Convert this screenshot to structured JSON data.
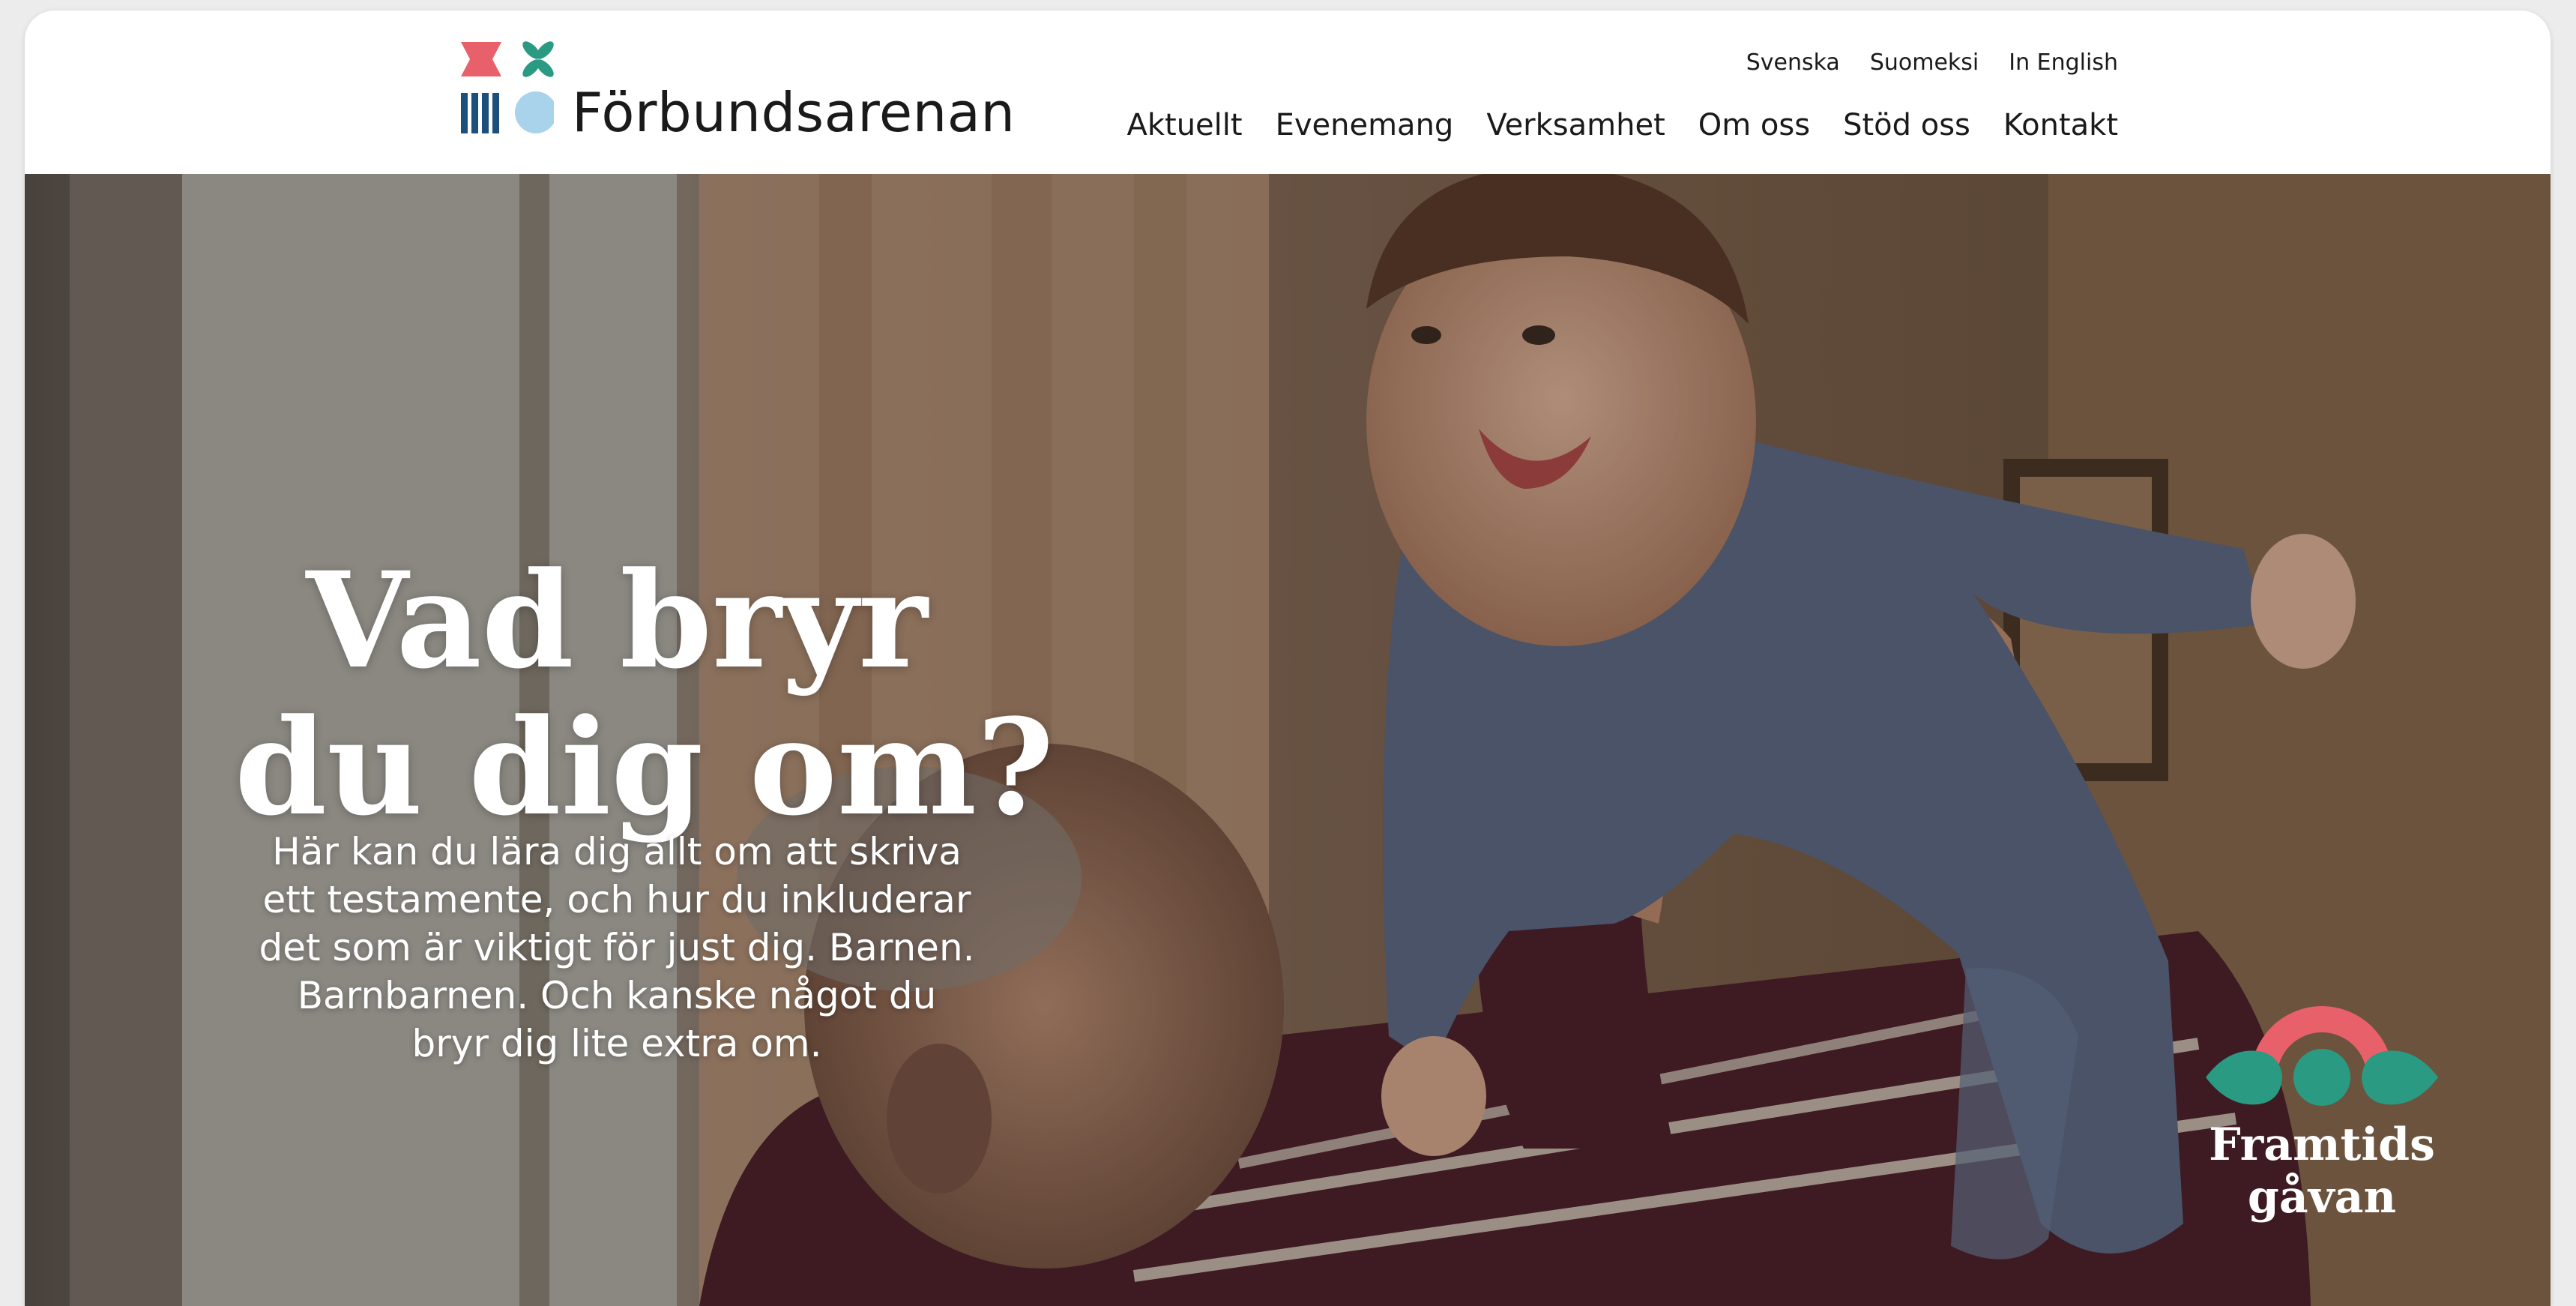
{
  "brand": {
    "name": "Förbundsarenan",
    "colors": {
      "coral": "#e8606a",
      "teal": "#2a9a82",
      "navy": "#1d4f7c",
      "light_blue": "#a9d3ea"
    }
  },
  "header": {
    "languages": [
      "Svenska",
      "Suomeksi",
      "In English"
    ],
    "nav": [
      "Aktuellt",
      "Evenemang",
      "Verksamhet",
      "Om oss",
      "Stöd oss",
      "Kontakt"
    ]
  },
  "hero": {
    "title_lines": [
      "Vad bryr",
      "du dig om?"
    ],
    "body": "Här kan du lära dig allt om att skriva ett testamente, och hur du inkluderar det som är viktigt för just dig. Barnen. Barnbarnen. Och kanske något du bryr dig lite extra om.",
    "badge": {
      "line1": "Framtids",
      "line2": "gåvan",
      "arc_color": "#e8606a",
      "leaf_color": "#2a9a82"
    }
  }
}
